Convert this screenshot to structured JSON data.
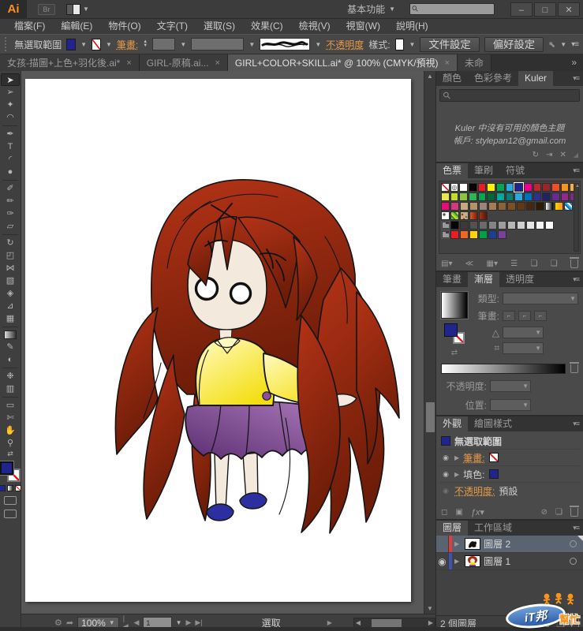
{
  "titlebar": {
    "logo": "Ai",
    "bridge": "Br",
    "workspace": "基本功能",
    "min": "–",
    "max": "□",
    "close": "✕"
  },
  "menus": [
    {
      "id": "file",
      "label": "檔案(F)"
    },
    {
      "id": "edit",
      "label": "編輯(E)"
    },
    {
      "id": "object",
      "label": "物件(O)"
    },
    {
      "id": "type",
      "label": "文字(T)"
    },
    {
      "id": "select",
      "label": "選取(S)"
    },
    {
      "id": "effect",
      "label": "效果(C)"
    },
    {
      "id": "view",
      "label": "檢視(V)"
    },
    {
      "id": "window",
      "label": "視窗(W)"
    },
    {
      "id": "help",
      "label": "說明(H)"
    }
  ],
  "control_bar": {
    "selection_status": "無選取範圍",
    "stroke_label": "筆畫:",
    "opacity_label": "不透明度",
    "style_label": "樣式:",
    "doc_setup": "文件設定",
    "preferences": "偏好設定",
    "fill_color": "#20248f"
  },
  "tabs": [
    {
      "title": "女孩-描圖+上色+羽化後.ai*",
      "close": "×",
      "active": false
    },
    {
      "title": "GIRL-原稿.ai...",
      "close": "×",
      "active": false
    },
    {
      "title": "GIRL+COLOR+SKILL.ai* @ 100% (CMYK/預視)",
      "close": "×",
      "active": true
    },
    {
      "title": "未命",
      "close": "",
      "active": false
    }
  ],
  "tabs_overflow": "»",
  "toolbar": {
    "tools": [
      {
        "name": "selection-tool",
        "glyph": "➤",
        "active": true
      },
      {
        "name": "direct-selection-tool",
        "glyph": "➢"
      },
      {
        "name": "magic-wand-tool",
        "glyph": "✦"
      },
      {
        "name": "lasso-tool",
        "glyph": "◠"
      },
      {
        "divider": true
      },
      {
        "name": "pen-tool",
        "glyph": "✒"
      },
      {
        "name": "type-tool",
        "glyph": "T"
      },
      {
        "name": "line-segment-tool",
        "glyph": "◜"
      },
      {
        "name": "ellipse-tool",
        "glyph": "●"
      },
      {
        "divider": true
      },
      {
        "name": "paintbrush-tool",
        "glyph": "✐"
      },
      {
        "name": "pencil-tool",
        "glyph": "✏"
      },
      {
        "name": "blob-brush-tool",
        "glyph": "✑"
      },
      {
        "name": "eraser-tool",
        "glyph": "▱"
      },
      {
        "divider": true
      },
      {
        "name": "rotate-tool",
        "glyph": "↻"
      },
      {
        "name": "scale-tool",
        "glyph": "◰"
      },
      {
        "name": "width-tool",
        "glyph": "⋈"
      },
      {
        "name": "free-transform-tool",
        "glyph": "▧"
      },
      {
        "name": "shape-builder-tool",
        "glyph": "◈"
      },
      {
        "name": "perspective-grid-tool",
        "glyph": "⊿"
      },
      {
        "name": "mesh-tool",
        "glyph": "▦"
      },
      {
        "divider": true
      },
      {
        "name": "gradient-tool",
        "glyph": "",
        "cls": "tool-grad"
      },
      {
        "name": "eyedropper-tool",
        "glyph": "✎"
      },
      {
        "name": "blend-tool",
        "glyph": "◐"
      },
      {
        "divider": true
      },
      {
        "name": "symbol-sprayer-tool",
        "glyph": "❉"
      },
      {
        "name": "column-graph-tool",
        "glyph": "▥"
      },
      {
        "divider": true
      },
      {
        "name": "artboard-tool",
        "glyph": "▭"
      },
      {
        "name": "slice-tool",
        "glyph": "✄"
      },
      {
        "name": "hand-tool",
        "glyph": "✋"
      },
      {
        "name": "zoom-tool",
        "glyph": "⚲"
      }
    ]
  },
  "panels": {
    "kuler": {
      "tabs": [
        "顏色",
        "色彩參考",
        "Kuler"
      ],
      "message_line1": "Kuler 中沒有可用的顏色主題",
      "message_line2": "帳戶: stylepan12@gmail.com"
    },
    "swatches": {
      "tabs": [
        "色票",
        "筆刷",
        "符號"
      ],
      "rows": [
        [
          "none",
          "reg",
          "#ffffff",
          "#000000",
          "#ed1c24",
          "#fff200",
          "#00a651",
          "#29abe2",
          "sel:#20248f",
          "#ec008c",
          "#c02630",
          "#93272b",
          "#f04e23",
          "#f7941d",
          "#fbaf3b"
        ],
        [
          "#e8e84a",
          "#c6d92d",
          "#8cc63f",
          "#2fb457",
          "#00a651",
          "#006838",
          "#00a99d",
          "#0e7c6e",
          "#29abe2",
          "#0071bc",
          "#2e3192",
          "#262262",
          "#662d91",
          "#92278f",
          "#7b2d84"
        ],
        [
          "#ec0b75",
          "#d4387f",
          "#c7a87f",
          "#b39267",
          "#9b8579",
          "#a67c52",
          "#8c6239",
          "#7a5024",
          "#603913",
          "#47270e",
          "#2f1a07",
          "grad:#ffffff,#000000",
          "grad:#ffd200,#f7941d",
          "pat:check"
        ],
        [
          "pat:dots",
          "pat:green",
          "pat:speckle",
          "grad:#d45a2e,#7e1a06",
          "grad:#a33312,#57130a"
        ],
        [
          "folder",
          "#060606",
          "#3a3a3a",
          "#525252",
          "#6b6b6b",
          "#848484",
          "#9d9d9d",
          "#b6b6b6",
          "#cfcfcf",
          "#e4e4e4",
          "#f3f3f3",
          "#ffffff"
        ],
        [
          "folder",
          "#ed1c24",
          "#f26522",
          "#ffd400",
          "#00a14b",
          "#1c3f94",
          "#7b3f9d"
        ]
      ]
    },
    "gradient": {
      "tabs": [
        "筆畫",
        "漸層",
        "透明度"
      ],
      "type_label": "類型:",
      "stroke_label": "筆畫:",
      "opacity_label": "不透明度:",
      "position_label": "位置:"
    },
    "appearance": {
      "tabs": [
        "外觀",
        "繪圖樣式"
      ],
      "header": "無選取範圍",
      "stroke_label": "筆畫:",
      "fill_label": "填色:",
      "opacity_label": "不透明度:",
      "opacity_value": "預設",
      "fill_color": "#20248f"
    },
    "layers": {
      "tabs": [
        "圖層",
        "工作區域"
      ],
      "rows": [
        {
          "name": "圖層 2",
          "bar": "#e23b3b",
          "selected": true,
          "visible": false
        },
        {
          "name": "圖層 1",
          "bar": "#3f51b5",
          "selected": false,
          "visible": true
        }
      ],
      "count_text": "2 個圖層"
    }
  },
  "status_bar": {
    "zoom": "100%",
    "page": "1",
    "status": "選取"
  },
  "watermark": {
    "part1": "iT邦",
    "part2": "幫忙"
  },
  "illustration": {
    "hair_top": "#b43316",
    "hair_dark": "#6c1c08",
    "skin": "#f3e9dc",
    "outline": "#161616",
    "eye_white": "#ffffff",
    "jacket_light": "#fffbc0",
    "jacket": "#f4de12",
    "button": "#8c4ea0",
    "skirt_dark": "#5c2e71",
    "skirt_light": "#aa79ba",
    "shoe": "#2b2f9f"
  }
}
